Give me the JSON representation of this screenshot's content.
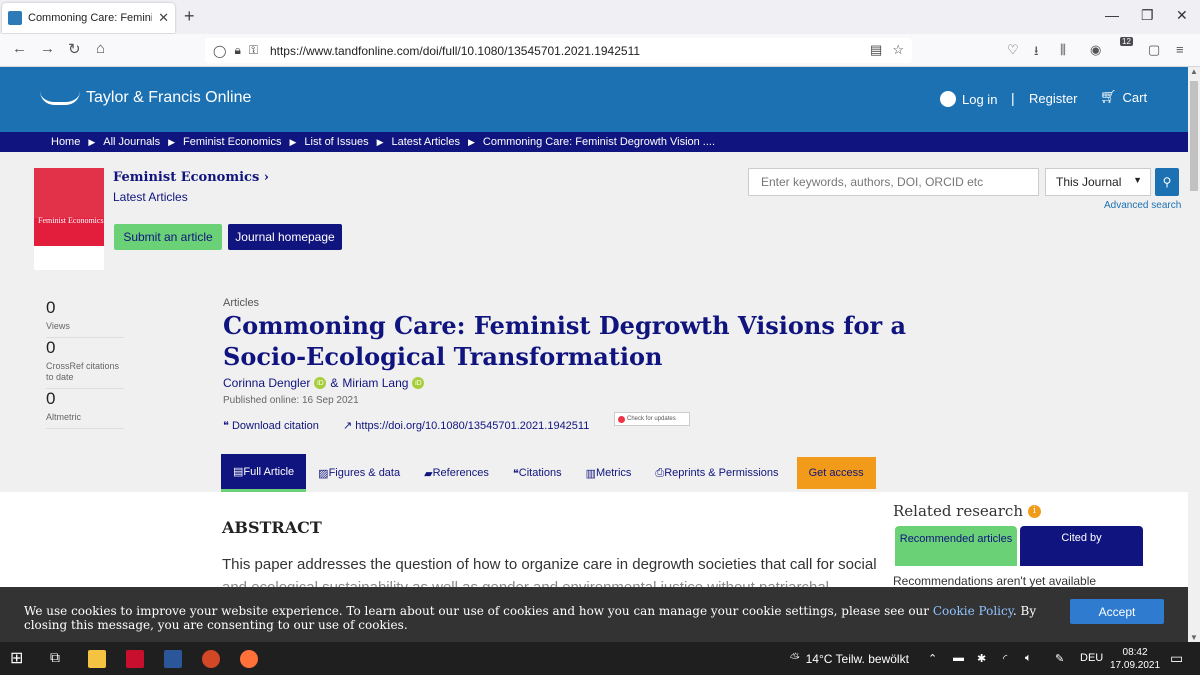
{
  "browser": {
    "tab_title": "Commoning Care: Feminist Deg",
    "url": "https://www.tandfonline.com/doi/full/10.1080/13545701.2021.1942511",
    "ext_badge": "12"
  },
  "site": {
    "logo_text": "Taylor & Francis Online",
    "login": "Log in",
    "register": "Register",
    "cart": "Cart"
  },
  "breadcrumb": [
    "Home",
    "All Journals",
    "Feminist Economics",
    "List of Issues",
    "Latest Articles",
    "Commoning Care: Feminist Degrowth Vision ...."
  ],
  "journal": {
    "name": "Feminist Economics ›",
    "sub": "Latest Articles",
    "cover_title": "Feminist Economics",
    "submit": "Submit an article",
    "homepage": "Journal homepage",
    "search_placeholder": "Enter keywords, authors, DOI, ORCID etc",
    "scope": "This Journal",
    "advanced": "Advanced search"
  },
  "metrics": [
    {
      "num": "0",
      "label": "Views"
    },
    {
      "num": "0",
      "label": "CrossRef citations to date"
    },
    {
      "num": "0",
      "label": "Altmetric"
    }
  ],
  "article": {
    "type": "Articles",
    "title": "Commoning Care: Feminist Degrowth Visions for a Socio-Ecological Transformation",
    "author1": "Corinna Dengler",
    "amp": "&",
    "author2": "Miriam Lang",
    "published": "Published online: 16 Sep 2021",
    "download_citation": "Download citation",
    "doi": "https://doi.org/10.1080/13545701.2021.1942511",
    "check_updates": "Check for updates"
  },
  "tabs": [
    "Full Article",
    "Figures & data",
    "References",
    "Citations",
    "Metrics",
    "Reprints & Permissions"
  ],
  "get_access": "Get access",
  "abstract": {
    "heading": "ABSTRACT",
    "line1": "This paper addresses the question of how to organize care in degrowth societies that call for social",
    "line2": "and ecological sustainability as well as gender and environmental justice without patriarchal"
  },
  "related": {
    "heading": "Related research",
    "tab_recommended": "Recommended articles",
    "tab_cited": "Cited by",
    "note": "Recommendations aren't yet available"
  },
  "cookie": {
    "text_before": "We use cookies to improve your website experience. To learn about our use of cookies and how you can manage your cookie settings, please see our",
    "link": "Cookie Policy",
    "text_after": ". By closing this message, you are consenting to our use of cookies.",
    "accept": "Accept"
  },
  "taskbar": {
    "weather": "14°C  Teilw. bewölkt",
    "lang": "DEU",
    "time": "08:42",
    "date": "17.09.2021"
  }
}
